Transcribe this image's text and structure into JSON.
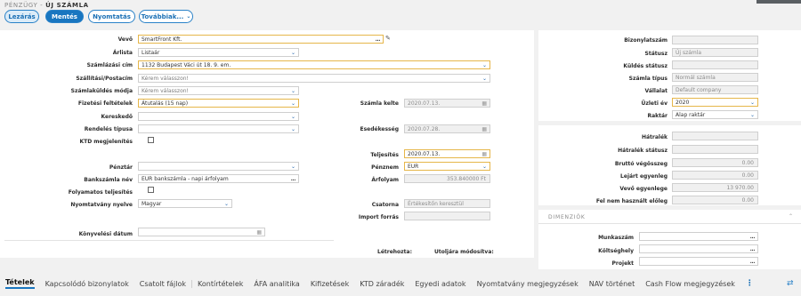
{
  "header": {
    "breadcrumb_root": "PÉNZÜGY",
    "breadcrumb_sep": " - ",
    "breadcrumb_page": "ÚJ SZÁMLA"
  },
  "toolbar": {
    "lezaras": "Lezárás",
    "mentes": "Mentés",
    "nyomtatas": "Nyomtatás",
    "tovabbiak": "Továbbiak...",
    "tovabbiak_icon": "chevron-down-icon"
  },
  "left": {
    "vevo_label": "Vevő",
    "vevo_value": "SmartFront Kft.",
    "arlista_label": "Árlista",
    "arlista_value": "Listaár",
    "szamlazasi_cim_label": "Számlázási cím",
    "szamlazasi_cim_value": "1132 Budapest Váci út 18. 9. em.",
    "szallitasi_label": "Szállítási/Postacím",
    "szallitasi_value": "Kérem válasszon!",
    "kuldes_modja_label": "Számlaküldés módja",
    "kuldes_modja_value": "Kérem válasszon!",
    "fizetesi_label": "Fizetési feltételek",
    "fizetesi_value": "Átutalás (15 nap)",
    "kereskedo_label": "Kereskedő",
    "kereskedo_value": "",
    "rendeles_label": "Rendelés típusa",
    "rendeles_value": "",
    "ktd_label": "KTD megjelenítés",
    "penztar_label": "Pénztár",
    "penztar_value": "",
    "bankszamla_label": "Bankszámla név",
    "bankszamla_value": "EUR bankszámla - napi árfolyam",
    "folyamatos_label": "Folyamatos teljesítés",
    "nyomtatvany_label": "Nyomtatvány nyelve",
    "nyomtatvany_value": "Magyar",
    "konyvelesi_label": "Könyvelési dátum",
    "konyvelesi_value": "",
    "szamla_kelte_label": "Számla kelte",
    "szamla_kelte_value": "2020.07.13.",
    "esedekesseg_label": "Esedékesség",
    "esedekesseg_value": "2020.07.28.",
    "teljesites_label": "Teljesítés",
    "teljesites_value": "2020.07.13.",
    "penznem_label": "Pénznem",
    "penznem_value": "EUR",
    "arfolyam_label": "Árfolyam",
    "arfolyam_value": "353.840000 Ft",
    "csatorna_label": "Csatorna",
    "csatorna_value": "Értékesítőn keresztül",
    "import_label": "Import forrás",
    "import_value": "",
    "letrehozta_label": "Létrehozta:",
    "utoljara_label": "Utoljára módosítva:"
  },
  "right": {
    "bizonylatszam_label": "Bizonylatszám",
    "bizonylatszam_value": "",
    "statusz_label": "Státusz",
    "statusz_value": "Új számla",
    "kuldes_statusz_label": "Küldés státusz",
    "kuldes_statusz_value": "",
    "szamla_tipus_label": "Számla típus",
    "szamla_tipus_value": "Normál számla",
    "vallalat_label": "Vállalat",
    "vallalat_value": "Default company",
    "uzleti_ev_label": "Üzleti év",
    "uzleti_ev_value": "2020",
    "raktar_label": "Raktár",
    "raktar_value": "Alap raktár",
    "hatralek_label": "Hátralék",
    "hatralek_value": "",
    "hatralek_statusz_label": "Hátralék státusz",
    "hatralek_statusz_value": "",
    "brutto_label": "Bruttó végösszeg",
    "brutto_value": "0.00",
    "lejart_label": "Lejárt egyenleg",
    "lejart_value": "0.00",
    "vevo_egyenleg_label": "Vevő egyenlege",
    "vevo_egyenleg_value": "13 970.00",
    "fel_nem_label": "Fel nem használt előleg",
    "fel_nem_value": "0.00",
    "dimenziok_title": "DIMENZIÓK",
    "munkaszam_label": "Munkaszám",
    "koltseghely_label": "Költséghely",
    "projekt_label": "Projekt"
  },
  "tabs": [
    "Tételek",
    "Kapcsolódó bizonylatok",
    "Csatolt fájlok",
    "Kontírtételek",
    "ÁFA analitika",
    "Kifizetések",
    "KTD záradék",
    "Egyedi adatok",
    "Nyomtatvány megjegyzések",
    "NAV történet",
    "Cash Flow megjegyzések"
  ],
  "tabs_more": "⋮",
  "colors": {
    "accent": "#1976c0",
    "highlight_border": "#e6b64a",
    "readonly_bg": "#f0f0f0"
  }
}
